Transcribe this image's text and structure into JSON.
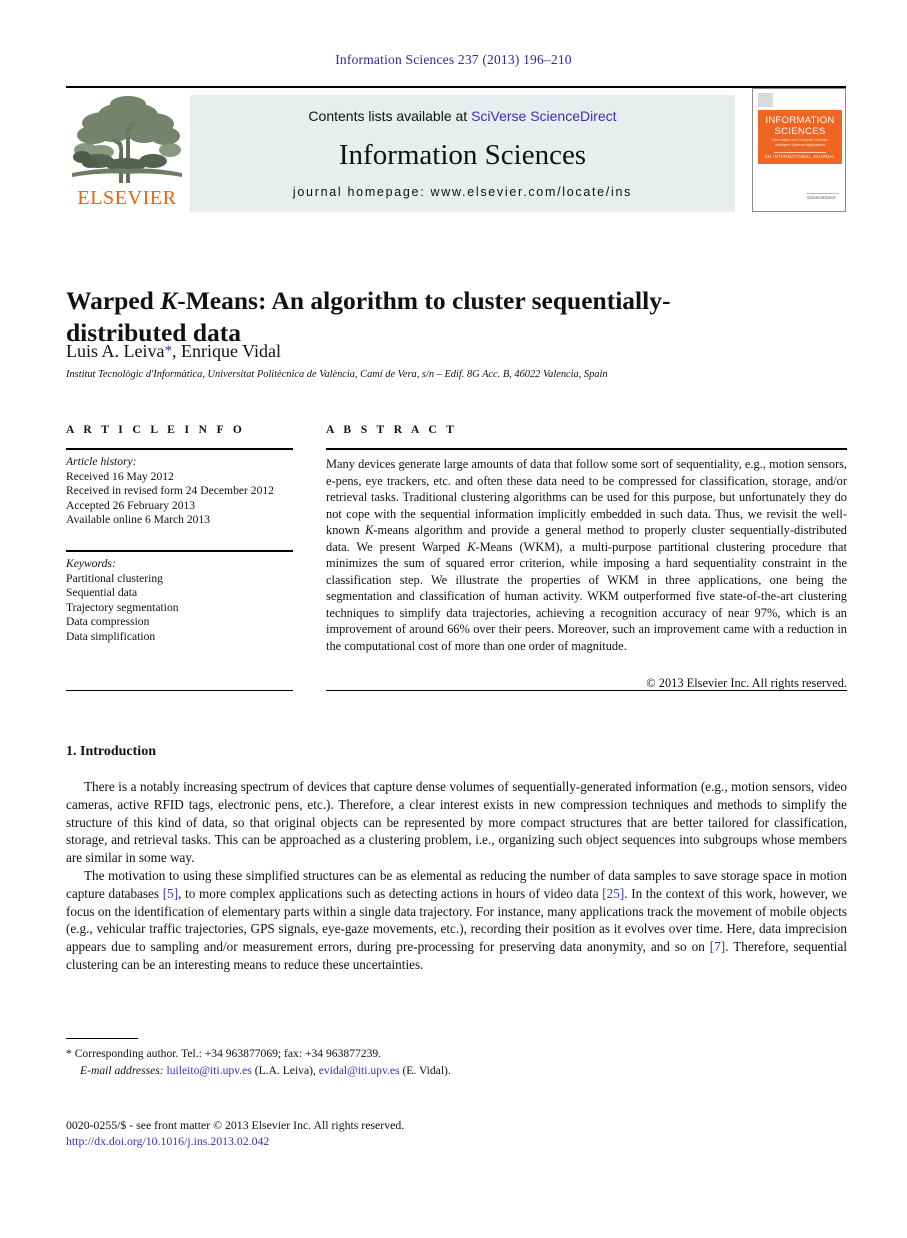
{
  "running_head": "Information Sciences 237 (2013) 196–210",
  "masthead": {
    "contents_prefix": "Contents lists available at ",
    "contents_link": "SciVerse ScienceDirect",
    "journal_title": "Information Sciences",
    "homepage": "journal homepage: www.elsevier.com/locate/ins",
    "publisher_word": "ELSEVIER",
    "cover": {
      "line1": "INFORMATION",
      "line2": "SCIENCES",
      "subtitle": "Informatics and Computer Science Intelligent Systems Applications",
      "international": "AN INTERNATIONAL JOURNAL",
      "footer": "ScienceDirect"
    }
  },
  "article": {
    "title": "Warped K-Means: An algorithm to cluster sequentially-distributed data",
    "title_part1": "Warped ",
    "title_italic": "K",
    "title_part2": "-Means: An algorithm to cluster sequentially-distributed data",
    "authors": "Luis A. Leiva , Enrique Vidal",
    "author_1": "Luis A. Leiva",
    "author_2": ", Enrique Vidal",
    "corresponding_marker": "*",
    "affiliation": "Institut Tecnològic d'Informàtica, Universitat Politècnica de València, Camí de Vera, s/n – Edif. 8G Acc. B, 46022 Valencia, Spain"
  },
  "article_info": {
    "heading": "A R T I C L E   I N F O",
    "history_label": "Article history:",
    "history": [
      "Received 16 May 2012",
      "Received in revised form 24 December 2012",
      "Accepted 26 February 2013",
      "Available online 6 March 2013"
    ],
    "keywords_label": "Keywords:",
    "keywords": [
      "Partitional clustering",
      "Sequential data",
      "Trajectory segmentation",
      "Data compression",
      "Data simplification"
    ]
  },
  "abstract": {
    "heading": "A B S T R A C T",
    "part1": "Many devices generate large amounts of data that follow some sort of sequentiality, e.g., motion sensors, e-pens, eye trackers, etc. and often these data need to be compressed for classification, storage, and/or retrieval tasks. Traditional clustering algorithms can be used for this purpose, but unfortunately they do not cope with the sequential information implicitly embedded in such data. Thus, we revisit the well-known ",
    "italic1": "K",
    "part2": "-means algorithm and provide a general method to properly cluster sequentially-distributed data. We present Warped ",
    "italic2": "K",
    "part3": "-Means (WKM), a multi-purpose partitional clustering procedure that minimizes the sum of squared error criterion, while imposing a hard sequentiality constraint in the classification step. We illustrate the properties of WKM in three applications, one being the segmentation and classification of human activity. WKM outperformed five state-of-the-art clustering techniques to simplify data trajectories, achieving a recognition accuracy of near 97%, which is an improvement of around 66% over their peers. Moreover, such an improvement came with a reduction in the computational cost of more than one order of magnitude.",
    "copyright": "© 2013 Elsevier Inc. All rights reserved."
  },
  "introduction": {
    "heading": "1. Introduction",
    "paragraph1": "There is a notably increasing spectrum of devices that capture dense volumes of sequentially-generated information (e.g., motion sensors, video cameras, active RFID tags, electronic pens, etc.). Therefore, a clear interest exists in new compression techniques and methods to simplify the structure of this kind of data, so that original objects can be represented by more compact structures that are better tailored for classification, storage, and retrieval tasks. This can be approached as a clustering problem, i.e., organizing such object sequences into subgroups whose members are similar in some way.",
    "p2_a": "The motivation to using these simplified structures can be as elemental as reducing the number of data samples to save storage space in motion capture databases ",
    "p2_ref1": "[5]",
    "p2_b": ", to more complex applications such as detecting actions in hours of video data ",
    "p2_ref2": "[25]",
    "p2_c": ". In the context of this work, however, we focus on the identification of elementary parts within a single data trajectory. For instance, many applications track the movement of mobile objects (e.g., vehicular traffic trajectories, GPS signals, eye-gaze movements, etc.), recording their position as it evolves over time. Here, data imprecision appears due to sampling and/or measurement errors, during pre-processing for preserving data anonymity, and so on ",
    "p2_ref3": "[7]",
    "p2_d": ". Therefore, sequential clustering can be an interesting means to reduce these uncertainties."
  },
  "footnotes": {
    "corresponding": "* Corresponding author. Tel.: +34 963877069; fax: +34 963877239.",
    "email_label": "E-mail addresses:",
    "email_1": "luileito@iti.upv.es",
    "email_1_name": " (L.A. Leiva), ",
    "email_2": "evidal@iti.upv.es",
    "email_2_name": " (E. Vidal)."
  },
  "colophon": {
    "issn_line": "0020-0255/$ - see front matter © 2013 Elsevier Inc. All rights reserved.",
    "doi": "http://dx.doi.org/10.1016/j.ins.2013.02.042"
  },
  "colors": {
    "link": "#3333b2",
    "running_head": "#2a2a96",
    "elsevier_orange": "#e8620c",
    "cover_orange": "#ef6522",
    "band_gray": "#e9edee"
  }
}
